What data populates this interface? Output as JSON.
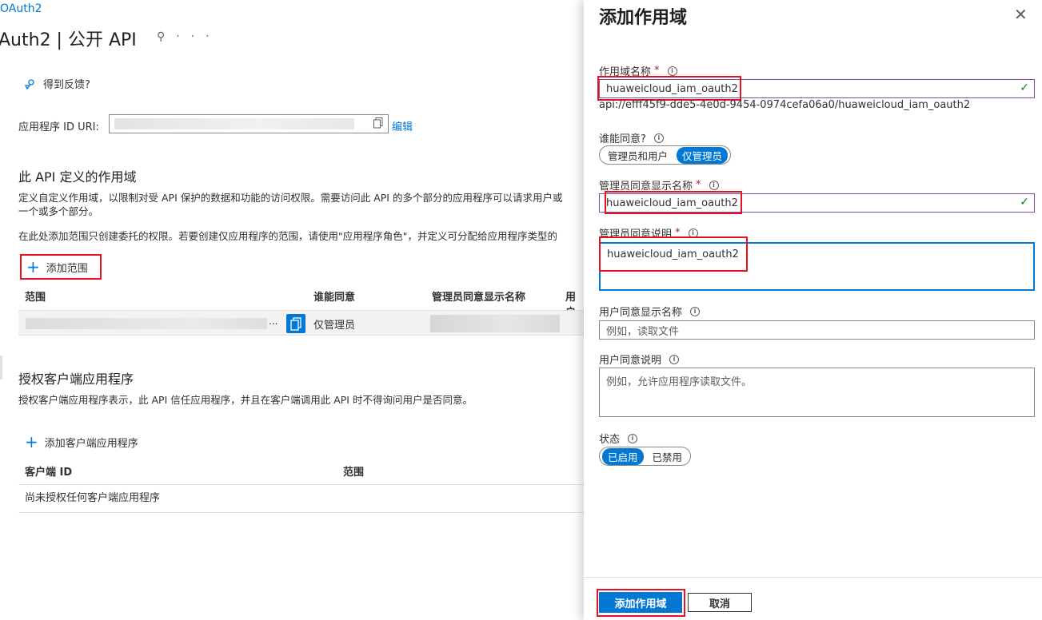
{
  "left": {
    "breadcrumb": "OAuth2",
    "title": "Auth2 | 公开 API",
    "title_icons": {
      "pin": "pin-icon",
      "more": "···"
    },
    "feedback": "得到反馈?",
    "app_id_uri_label": "应用程序 ID URI:",
    "edit_link": "编辑",
    "scopes_section": {
      "title": "此 API 定义的作用域",
      "desc_line1": "定义自定义作用域，以限制对受 API 保护的数据和功能的访问权限。需要访问此 API 的多个部分的应用程序可以请求用户或",
      "desc_line2": "一个或多个部分。",
      "desc2": "在此处添加范围只创建委托的权限。若要创建仅应用程序的范围，请使用\"应用程序角色\"，并定义可分配给应用程序类型的",
      "add_button": "添加范围",
      "columns": [
        "范围",
        "谁能同意",
        "管理员同意显示名称",
        "用户"
      ],
      "row": {
        "ellipsis": "...",
        "who_consent": "仅管理员"
      }
    },
    "clients_section": {
      "title": "授权客户端应用程序",
      "desc": "授权客户端应用程序表示，此 API 信任应用程序，并且在客户端调用此 API 时不得询问用户是否同意。",
      "add_button": "添加客户端应用程序",
      "columns": [
        "客户端 ID",
        "范围"
      ],
      "empty": "尚未授权任何客户端应用程序"
    }
  },
  "panel": {
    "title": "添加作用域",
    "close": "✕",
    "scope_name": {
      "label": "作用域名称",
      "value": "huaweicloud_iam_oauth2",
      "uri": "api://efff45f9-dde5-4e0d-9454-0974cefa06a0/huaweicloud_iam_oauth2"
    },
    "who_consent": {
      "label": "谁能同意?",
      "options": [
        "管理员和用户",
        "仅管理员"
      ],
      "selected": "仅管理员"
    },
    "admin_display": {
      "label": "管理员同意显示名称",
      "value": "huaweicloud_iam_oauth2"
    },
    "admin_desc": {
      "label": "管理员同意说明",
      "value": "huaweicloud_iam_oauth2"
    },
    "user_display": {
      "label": "用户同意显示名称",
      "placeholder": "例如，读取文件"
    },
    "user_desc": {
      "label": "用户同意说明",
      "placeholder": "例如，允许应用程序读取文件。"
    },
    "state": {
      "label": "状态",
      "options": [
        "已启用",
        "已禁用"
      ],
      "selected": "已启用"
    },
    "add_button": "添加作用域",
    "cancel_button": "取消",
    "required_mark": "*",
    "info_mark": "i",
    "check_mark": "✓"
  },
  "colors": {
    "accent": "#0078d4",
    "highlight": "#e81123",
    "valid_check": "#107c10"
  }
}
